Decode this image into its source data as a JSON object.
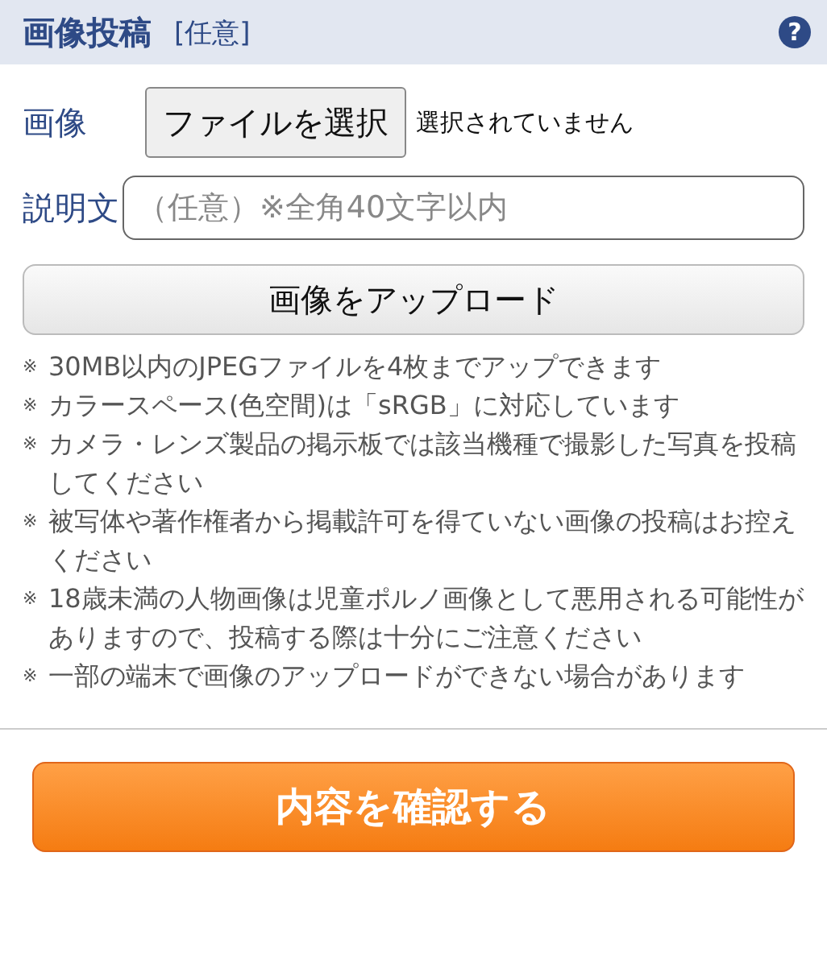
{
  "header": {
    "title": "画像投稿",
    "tag": "[任意]",
    "help": "?"
  },
  "image_field": {
    "label": "画像",
    "button": "ファイルを選択",
    "status": "選択されていません"
  },
  "description_field": {
    "label": "説明文",
    "placeholder": "（任意）※全角40文字以内"
  },
  "upload_button": "画像をアップロード",
  "notes": [
    {
      "mark": "※",
      "text": "30MB以内のJPEGファイルを4枚までアップできます"
    },
    {
      "mark": "※",
      "text": "カラースペース(色空間)は「sRGB」に対応しています"
    },
    {
      "mark": "※",
      "text": "カメラ・レンズ製品の掲示板では該当機種で撮影した写真を投稿してください"
    },
    {
      "mark": "※",
      "text": "被写体や著作権者から掲載許可を得ていない画像の投稿はお控えください"
    },
    {
      "mark": "※",
      "text": "18歳未満の人物画像は児童ポルノ画像として悪用される可能性がありますので、投稿する際は十分にご注意ください"
    },
    {
      "mark": "※",
      "text": "一部の端末で画像のアップロードができない場合があります"
    }
  ],
  "confirm_button": "内容を確認する"
}
